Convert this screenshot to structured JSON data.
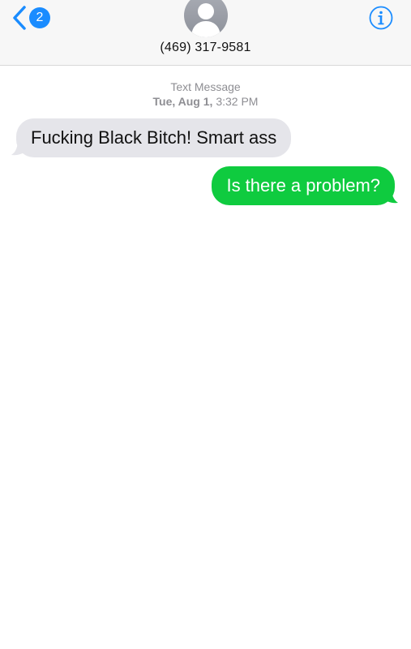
{
  "header": {
    "back_badge_count": "2",
    "contact_phone": "(469) 317-9581",
    "icons": {
      "back": "chevron-left-icon",
      "avatar": "person-silhouette-icon",
      "info": "info-icon"
    }
  },
  "timestamp": {
    "label": "Text Message",
    "date": "Tue, Aug 1,",
    "time": "3:32 PM"
  },
  "messages": [
    {
      "direction": "incoming",
      "text": "Fucking Black Bitch! Smart ass"
    },
    {
      "direction": "outgoing",
      "text": "Is there a problem?"
    }
  ],
  "colors": {
    "accent": "#1a8cff",
    "incoming_bubble": "#e5e5ea",
    "outgoing_bubble": "#0fcb3f",
    "header_bg": "#f7f7f7"
  }
}
